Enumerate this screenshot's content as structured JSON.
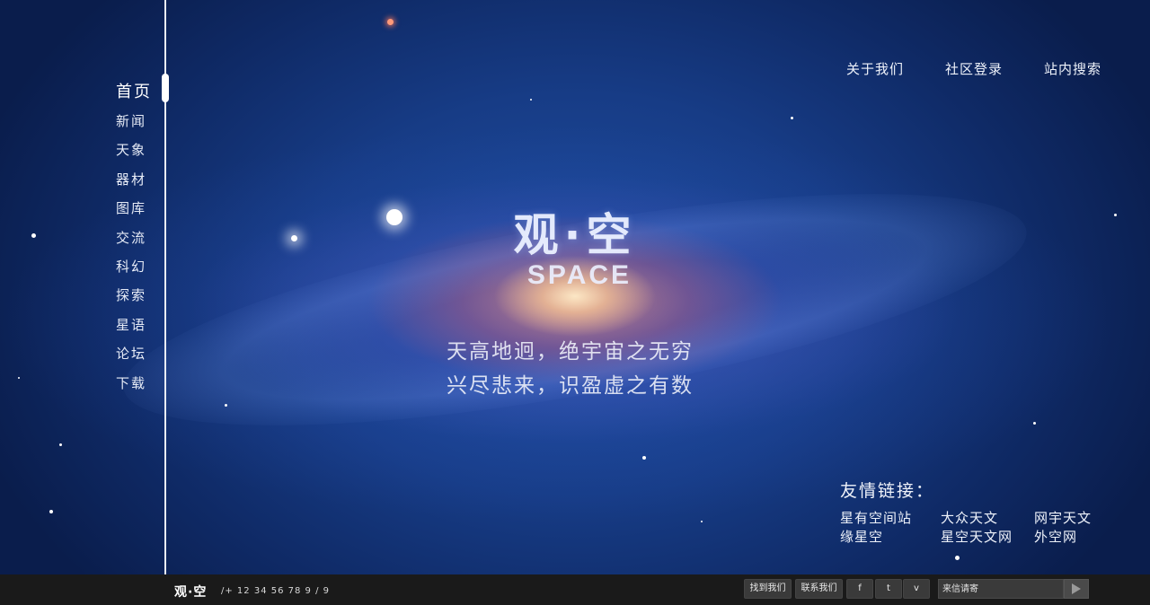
{
  "nav": {
    "items": [
      {
        "label": "首页",
        "active": true
      },
      {
        "label": "新闻"
      },
      {
        "label": "天象"
      },
      {
        "label": "器材"
      },
      {
        "label": "图库"
      },
      {
        "label": "交流"
      },
      {
        "label": "科幻"
      },
      {
        "label": "探索"
      },
      {
        "label": "星语"
      },
      {
        "label": "论坛"
      },
      {
        "label": "下载"
      }
    ]
  },
  "header": {
    "links": [
      "关于我们",
      "社区登录",
      "站内搜索"
    ]
  },
  "hero": {
    "title_cn": "观·空",
    "title_en": "SPACE",
    "verse_line1": "天高地迥，绝宇宙之无穷",
    "verse_line2": "兴尽悲来，识盈虚之有数"
  },
  "friends": {
    "title": "友情链接：",
    "links": [
      "星有空间站",
      "大众天文",
      "网宇天文",
      "缘星空",
      "星空天文网",
      "外空网"
    ]
  },
  "footer": {
    "brand": "观·空",
    "phone": "/+ 12 34 56 78 9 / 9",
    "find_us": "找到我们",
    "contact_us": "联系我们",
    "social": [
      "f",
      "t",
      "v"
    ],
    "mail_placeholder": "来信请寄"
  },
  "colors": {
    "rail": "#e8ecf5",
    "footer_bg": "#1a1a1a",
    "space_blue": "#173c86"
  }
}
